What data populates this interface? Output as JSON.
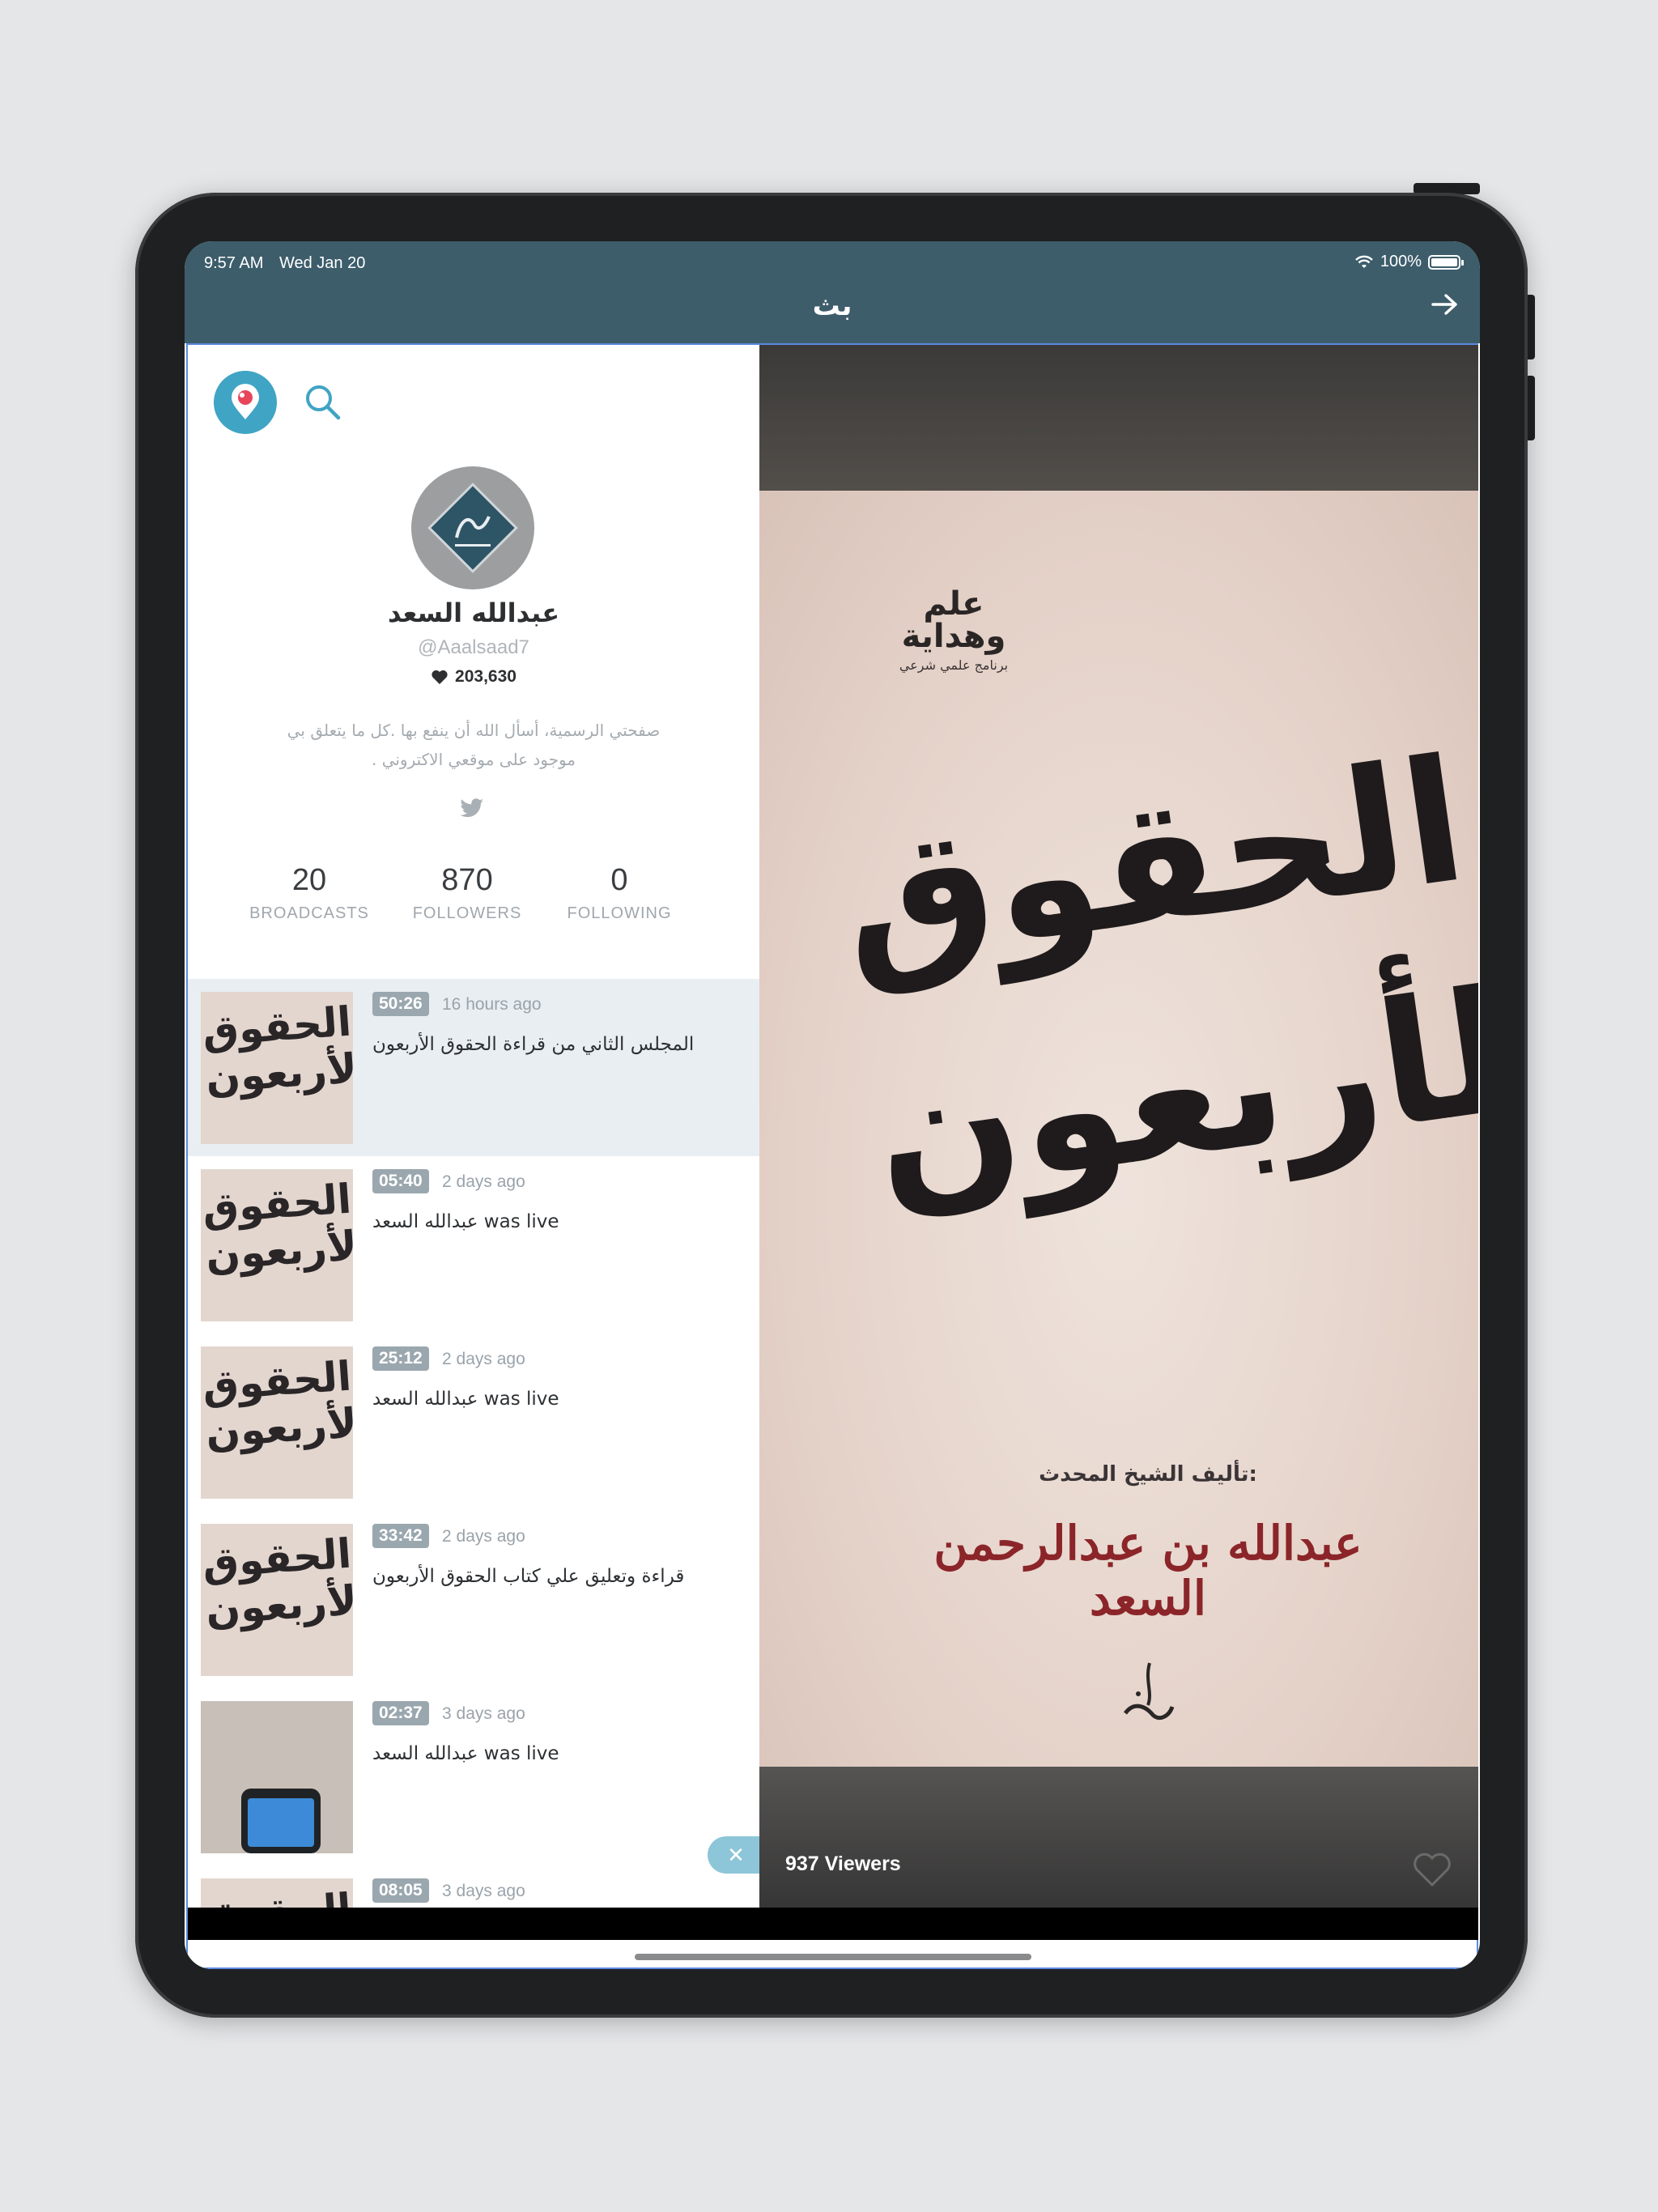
{
  "status_bar": {
    "time": "9:57 AM",
    "date": "Wed Jan 20",
    "battery": "100%"
  },
  "nav": {
    "title": "بث",
    "forward_icon": "arrow-right-icon"
  },
  "profile": {
    "display_name": "عبدالله السعد",
    "handle": "@Aaalsaad7",
    "hearts": "203,630",
    "bio_line1": "صفحتي الرسمية، أسأل الله أن ينفع بها .كل ما يتعلق بي",
    "bio_line2": "موجود على موقعي الاكتروني .",
    "stats": {
      "broadcasts_count": "20",
      "broadcasts_label": "BROADCASTS",
      "followers_count": "870",
      "followers_label": "FOLLOWERS",
      "following_count": "0",
      "following_label": "FOLLOWING"
    }
  },
  "broadcasts": [
    {
      "duration": "50:26",
      "time_ago": "16 hours ago",
      "title": "المجلس الثاني من قراءة الحقوق الأربعون",
      "thumb": "book-cover"
    },
    {
      "duration": "05:40",
      "time_ago": "2 days ago",
      "title": "عبدالله السعد was live",
      "thumb": "book-cover"
    },
    {
      "duration": "25:12",
      "time_ago": "2 days ago",
      "title": "عبدالله السعد was live",
      "thumb": "book-cover"
    },
    {
      "duration": "33:42",
      "time_ago": "2 days ago",
      "title": "قراءة وتعليق علي كتاب الحقوق الأربعون",
      "thumb": "book-cover"
    },
    {
      "duration": "02:37",
      "time_ago": "3 days ago",
      "title": "عبدالله السعد was live",
      "thumb": "phone"
    },
    {
      "duration": "08:05",
      "time_ago": "3 days ago",
      "title": "",
      "thumb": "book-cover"
    }
  ],
  "thumb_text": "الحقوق الأربعون",
  "video": {
    "brand": "علم وهداية",
    "brand_sub": "برنامج علمي شرعي",
    "book_title": "الحقوق الأربعون",
    "author_label": "تأليف الشيخ المحدث:",
    "author": "عبدالله بن عبدالرحمن السعد",
    "viewers": "937 Viewers"
  },
  "colors": {
    "header": "#3d5d6b",
    "accent": "#40a4c4",
    "selected_row": "#e9eef2"
  }
}
